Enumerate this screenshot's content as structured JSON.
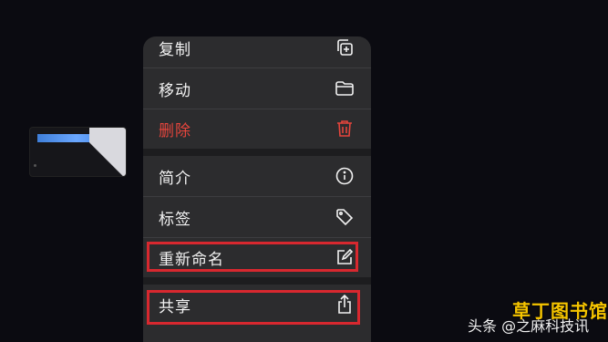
{
  "menu": {
    "items": [
      {
        "label": "复制",
        "icon": "duplicate-icon"
      },
      {
        "label": "移动",
        "icon": "folder-icon"
      },
      {
        "label": "删除",
        "icon": "trash-icon",
        "color": "#e5453c"
      },
      {
        "label": "简介",
        "icon": "info-icon"
      },
      {
        "label": "标签",
        "icon": "tag-icon"
      },
      {
        "label": "重新命名",
        "icon": "rename-icon"
      },
      {
        "label": "共享",
        "icon": "share-icon"
      }
    ]
  },
  "highlight_color": "#d8282f",
  "watermark": {
    "left_text": "头条 @之麻科技讯",
    "stamp_text": "草丁图书馆"
  }
}
